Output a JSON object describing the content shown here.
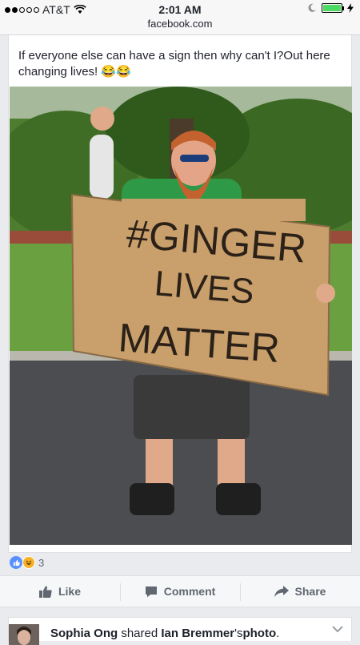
{
  "status_bar": {
    "carrier": "AT&T",
    "time": "2:01 AM",
    "url": "facebook.com"
  },
  "post": {
    "text": "If everyone else can have a sign then why can't I?Out here changing lives! 😂😂",
    "photo": {
      "sign_lines": [
        "#GINGER",
        "LIVES",
        "MATTER"
      ]
    },
    "reactions": {
      "icons": [
        "like-icon",
        "haha-icon"
      ],
      "count": "3"
    }
  },
  "actions": {
    "like": "Like",
    "comment": "Comment",
    "share": "Share"
  },
  "next_story": {
    "actor": "Sophia Ong",
    "verb": " shared ",
    "subject": "Ian Bremmer",
    "possessive": "'s",
    "object": "photo",
    "end": "."
  },
  "colors": {
    "like_blue": "#5890ff",
    "haha_yellow": "#f7b125",
    "battery_green": "#4cd964"
  }
}
